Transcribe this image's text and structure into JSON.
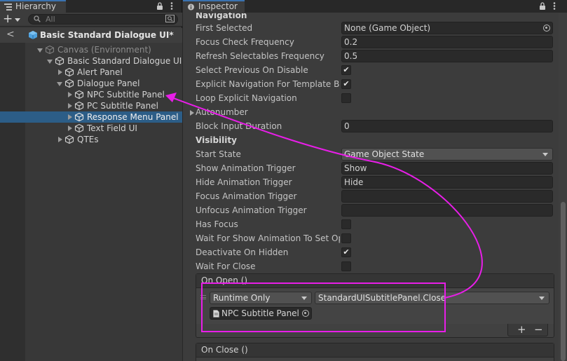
{
  "hierarchy": {
    "tab_title": "Hierarchy",
    "search_placeholder": "All",
    "add_symbol": "+",
    "scene_title": "Basic Standard Dialogue UI*",
    "back_symbol": "<",
    "items": [
      {
        "label": "Canvas (Environment)"
      },
      {
        "label": "Basic Standard Dialogue UI"
      },
      {
        "label": "Alert Panel"
      },
      {
        "label": "Dialogue Panel"
      },
      {
        "label": "NPC Subtitle Panel"
      },
      {
        "label": "PC Subtitle Panel"
      },
      {
        "label": "Response Menu Panel"
      },
      {
        "label": "Text Field UI"
      },
      {
        "label": "QTEs"
      }
    ]
  },
  "inspector": {
    "tab_title": "Inspector",
    "section_navigation": "Navigation",
    "first_selected_label": "First Selected",
    "first_selected_value": "None (Game Object)",
    "focus_check_label": "Focus Check Frequency",
    "focus_check_value": "0.2",
    "refresh_label": "Refresh Selectables Frequency",
    "refresh_value": "0.5",
    "select_prev_label": "Select Previous On Disable",
    "explicit_nav_label": "Explicit Navigation For Template Butt",
    "loop_nav_label": "Loop Explicit Navigation",
    "autonumber_label": "Autonumber",
    "block_input_label": "Block Input Duration",
    "block_input_value": "0",
    "section_visibility": "Visibility",
    "start_state_label": "Start State",
    "start_state_value": "Game Object State",
    "show_trigger_label": "Show Animation Trigger",
    "show_trigger_value": "Show",
    "hide_trigger_label": "Hide Animation Trigger",
    "hide_trigger_value": "Hide",
    "focus_trigger_label": "Focus Animation Trigger",
    "focus_trigger_value": "",
    "unfocus_trigger_label": "Unfocus Animation Trigger",
    "unfocus_trigger_value": "",
    "has_focus_label": "Has Focus",
    "wait_show_label": "Wait For Show Animation To Set Ope",
    "deactivate_label": "Deactivate On Hidden",
    "wait_close_label": "Wait For Close",
    "check_mark": "✔",
    "on_open": {
      "header": "On Open ()",
      "runtime_value": "Runtime Only",
      "function_value": "StandardUISubtitlePanel.Close",
      "target_object": "NPC Subtitle Panel",
      "plus": "+",
      "minus": "−"
    },
    "on_close": {
      "header": "On Close ()"
    }
  },
  "colors": {
    "annotation": "#e81ee8",
    "selection": "#2c5d87",
    "tab_accent": "#3a72b0"
  }
}
